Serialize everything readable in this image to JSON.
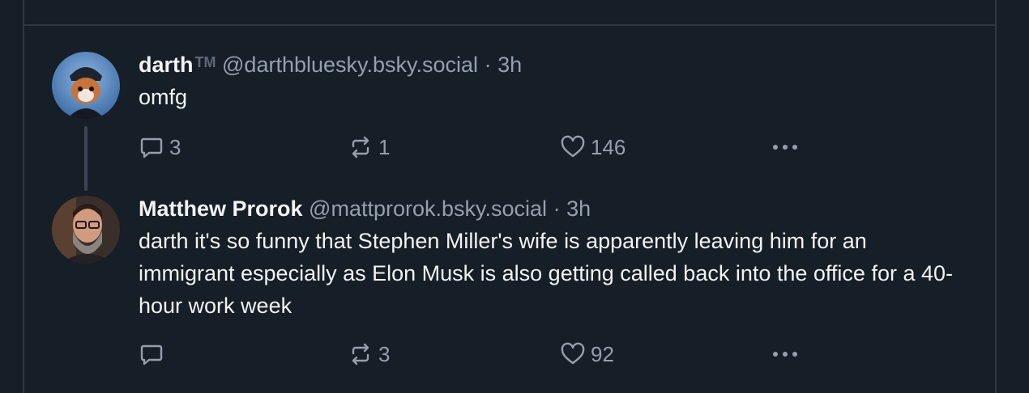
{
  "posts": [
    {
      "display_name": "darth",
      "badge": "TM",
      "handle": "@darthbluesky.bsky.social",
      "separator": "·",
      "time": "3h",
      "text": "omfg",
      "replies": "3",
      "reposts": "1",
      "likes": "146"
    },
    {
      "display_name": "Matthew Prorok",
      "handle": "@mattprorok.bsky.social",
      "separator": "·",
      "time": "3h",
      "text": "darth it's so funny that Stephen Miller's wife is apparently leaving him for an immigrant especially as Elon Musk is also getting called back into the office for a 40-hour work week",
      "replies": "",
      "reposts": "3",
      "likes": "92"
    }
  ],
  "icons": {
    "reply": "reply-icon",
    "repost": "repost-icon",
    "like": "heart-icon",
    "more": "more-options-icon"
  },
  "colors": {
    "background": "#161e27",
    "border": "#2e3844",
    "text": "#f1f3f5",
    "muted": "#95a0ad"
  }
}
